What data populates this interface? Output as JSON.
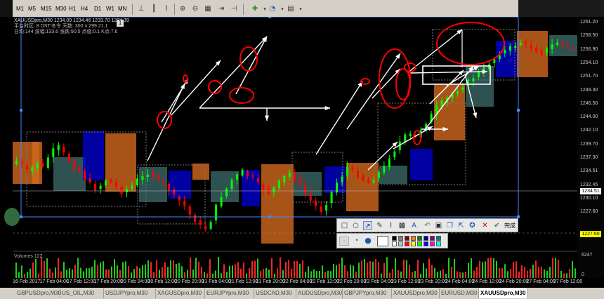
{
  "chart": {
    "symbol_line": "XAUUSDpro,M30  1234.09 1234.46 1233.70 1234.39",
    "info_line2": "平台时区: 8  DST:冬令  天数: 300  n:299  21.1",
    "info_line3": "日均:144  波幅:133.6  涨跌:90.5  点值:0.1  K点:7.6",
    "close_box": "1",
    "price_levels": [
      "1261.20",
      "1258.50",
      "1256.90",
      "1254.10",
      "1251.70",
      "1249.30",
      "1246.50",
      "1244.00",
      "1242.10",
      "1239.70",
      "1237.30",
      "1234.51",
      "1232.45",
      "1230.10",
      "1227.60"
    ],
    "current_price": "1234.51",
    "current_price_color": "#ffffff",
    "alt_price": "1227.60",
    "alt_price_color": "#ffff00",
    "volume_label": "Volumes 122",
    "volume_scale": "6247",
    "volume_zero": "0",
    "colors": {
      "bull_candle": "#00ff00",
      "bear_candle": "#ff0000",
      "zone_orange": "#d2691e",
      "zone_blue": "#0000cc",
      "zone_teal": "#3a6666",
      "annotation_red": "#ff0000",
      "annotation_white": "#ffffff",
      "selection_blue": "#4488ff"
    }
  },
  "toolbar": {
    "timeframes": [
      "M1",
      "M5",
      "M15",
      "M30",
      "H1",
      "H4",
      "D1",
      "W1",
      "MN"
    ],
    "icons": [
      "line-studies-icon",
      "bar-chart-icon",
      "candlestick-icon",
      "line-chart-icon",
      "zoom-in-icon",
      "zoom-out-icon",
      "tile-icon",
      "autoscroll-icon",
      "chart-shift-icon",
      "indicators-icon",
      "periods-icon",
      "templates-icon"
    ]
  },
  "time_axis": [
    "16 Feb 2017",
    "17 Feb 04:00",
    "17 Feb 12:00",
    "17 Feb 20:00",
    "20 Feb 04:00",
    "20 Feb 12:00",
    "20 Feb 20:00",
    "21 Feb 04:00",
    "21 Feb 12:00",
    "21 Feb 20:00",
    "22 Feb 04:00",
    "22 Feb 12:00",
    "22 Feb 20:00",
    "23 Feb 04:00",
    "23 Feb 12:00",
    "23 Feb 20:00",
    "24 Feb 04:00",
    "24 Feb 12:00",
    "24 Feb 20:00",
    "27 Feb 04:00",
    "27 Feb 12:00"
  ],
  "tabs": [
    "GBPUSDpro,M30",
    "US_OIL,M30",
    "USDJPYpro,M30",
    "XAGUSDpro,M30",
    "EURJPYpro,M30",
    "USDCAD,M30",
    "AUDUSDpro,M30",
    "GBPJPYpro,M30",
    "XAUUSDpro,M30",
    "EURUSD,M30",
    "XAUUSDpro,M30"
  ],
  "active_tab": "XAUUSDpro,M30",
  "drawing_toolbar": {
    "tools": [
      "rectangle-icon",
      "ellipse-icon",
      "arrow-icon",
      "pen-icon",
      "highlighter-icon",
      "mosaic-icon",
      "text-icon",
      "undo-icon",
      "save-icon",
      "copy-icon",
      "pin-icon",
      "share-icon",
      "bookmark-icon"
    ],
    "cancel_icon": "close-icon",
    "done_label": "完成"
  },
  "palette": {
    "colors": [
      "#000000",
      "#808080",
      "#800000",
      "#ff8000",
      "#008000",
      "#000080",
      "#800080",
      "#008080",
      "#ffffff",
      "#c0c0c0",
      "#ff0000",
      "#ffff00",
      "#00ff00",
      "#0000ff",
      "#ff00ff",
      "#00ffff"
    ],
    "selected": "#ffffff"
  }
}
